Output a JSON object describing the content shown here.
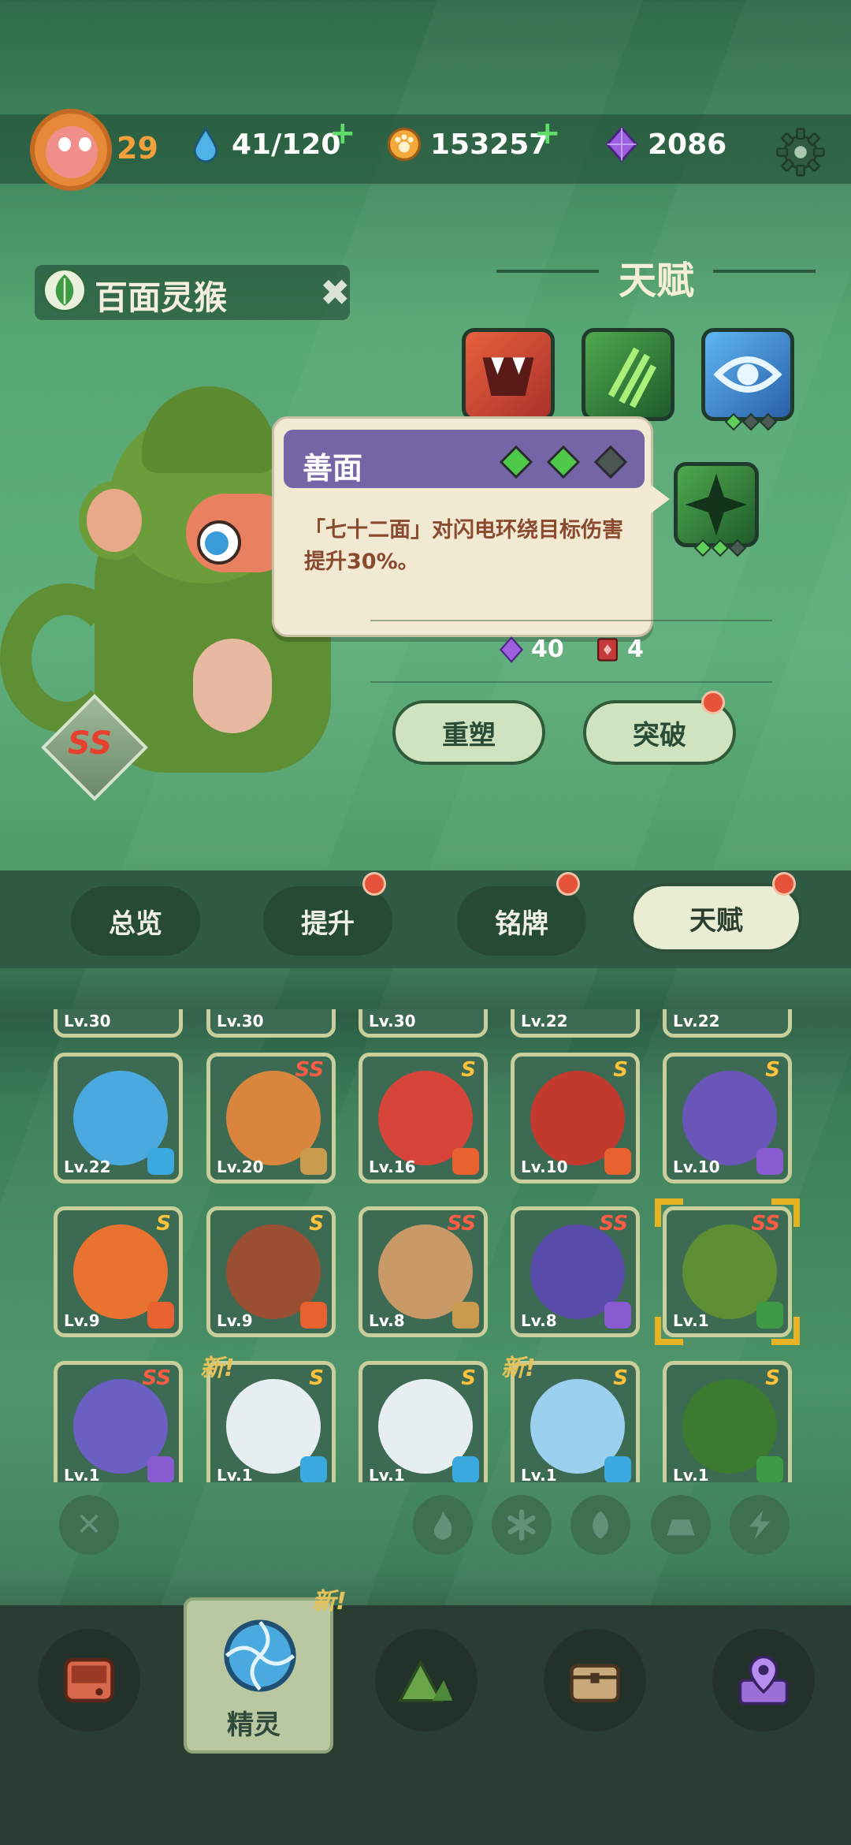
{
  "hud": {
    "player_level": "29",
    "energy": "41/120",
    "coins": "153257",
    "gems": "2086",
    "plus": "+"
  },
  "creature": {
    "name": "百面灵猴",
    "rank": "SS"
  },
  "talent": {
    "title": "天赋",
    "tooltip_title": "善面",
    "tooltip_desc": "「七十二面」对闪电环绕目标伤害提升30%。",
    "cost_gems": "40",
    "cost_books": "4",
    "reshape_label": "重塑",
    "breakthrough_label": "突破"
  },
  "tabs": [
    "总览",
    "提升",
    "铭牌",
    "天赋"
  ],
  "grid": {
    "top_row_levels": [
      "Lv.30",
      "Lv.30",
      "Lv.30",
      "Lv.22",
      "Lv.22"
    ],
    "rows": [
      [
        {
          "lv": "Lv.22",
          "rank": "",
          "el": "ice"
        },
        {
          "lv": "Lv.20",
          "rank": "SS",
          "el": "earth"
        },
        {
          "lv": "Lv.16",
          "rank": "S",
          "el": "fire"
        },
        {
          "lv": "Lv.10",
          "rank": "S",
          "el": "fire"
        },
        {
          "lv": "Lv.10",
          "rank": "S",
          "el": "thunder"
        }
      ],
      [
        {
          "lv": "Lv.9",
          "rank": "S",
          "el": "fire"
        },
        {
          "lv": "Lv.9",
          "rank": "S",
          "el": "fire"
        },
        {
          "lv": "Lv.8",
          "rank": "SS",
          "el": "earth"
        },
        {
          "lv": "Lv.8",
          "rank": "SS",
          "el": "thunder"
        },
        {
          "lv": "Lv.1",
          "rank": "SS",
          "el": "leaf"
        }
      ],
      [
        {
          "lv": "Lv.1",
          "rank": "SS",
          "el": "thunder"
        },
        {
          "lv": "Lv.1",
          "rank": "S",
          "el": "ice"
        },
        {
          "lv": "Lv.1",
          "rank": "S",
          "el": "ice"
        },
        {
          "lv": "Lv.1",
          "rank": "S",
          "el": "ice"
        },
        {
          "lv": "Lv.1",
          "rank": "S",
          "el": "leaf"
        }
      ]
    ],
    "new_label": "新!"
  },
  "filters": [
    "fire-icon",
    "ice-icon",
    "leaf-icon",
    "earth-icon",
    "thunder-icon"
  ],
  "nav": {
    "active_label": "精灵",
    "new_label": "新!"
  },
  "colors": {
    "fire": "#e8612f",
    "ice": "#3aa9e0",
    "leaf": "#3f9a45",
    "earth": "#c99b4f",
    "thunder": "#8a5ad1"
  }
}
